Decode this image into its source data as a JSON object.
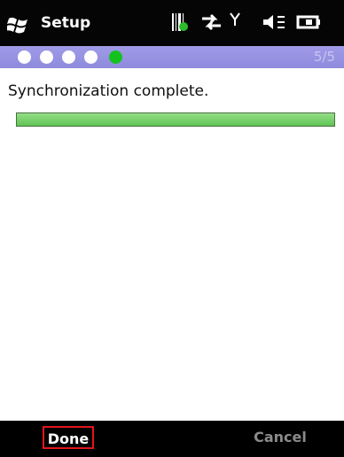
{
  "title_bar": {
    "title": "Setup",
    "icons": [
      "windows-logo",
      "barcode-scanner-icon",
      "data-connection-icon",
      "signal-strength-icon",
      "volume-icon",
      "battery-icon"
    ]
  },
  "progress": {
    "total_steps": 5,
    "current_step": 5,
    "counter_label": "5/5"
  },
  "content": {
    "message": "Synchronization complete.",
    "progress_fraction": 1.0
  },
  "softkeys": {
    "left_label": "Done",
    "right_label": "Cancel"
  },
  "colors": {
    "title_bar_background": "#050505",
    "step_bar_background": "#9b97e6",
    "active_step": "#14c21f",
    "progress_fill": "#7dd46f",
    "focus_outline": "#e2141d"
  }
}
